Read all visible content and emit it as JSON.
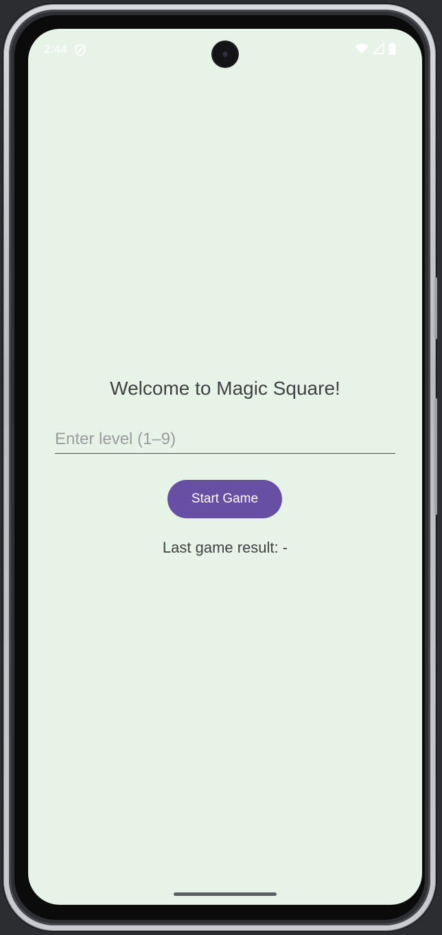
{
  "status_bar": {
    "time": "2:44",
    "left_icons": [
      "shield-icon"
    ],
    "right_icons": [
      "wifi-icon",
      "cellular-signal-icon",
      "battery-icon"
    ]
  },
  "main": {
    "title": "Welcome to Magic Square!",
    "level_input": {
      "value": "",
      "placeholder": "Enter level (1–9)"
    },
    "start_button_label": "Start Game",
    "result_text": "Last game result: -"
  },
  "colors": {
    "background": "#e8f3e7",
    "primary_button": "#6750a4",
    "text": "#3f4145",
    "placeholder": "#9a9c9f"
  }
}
